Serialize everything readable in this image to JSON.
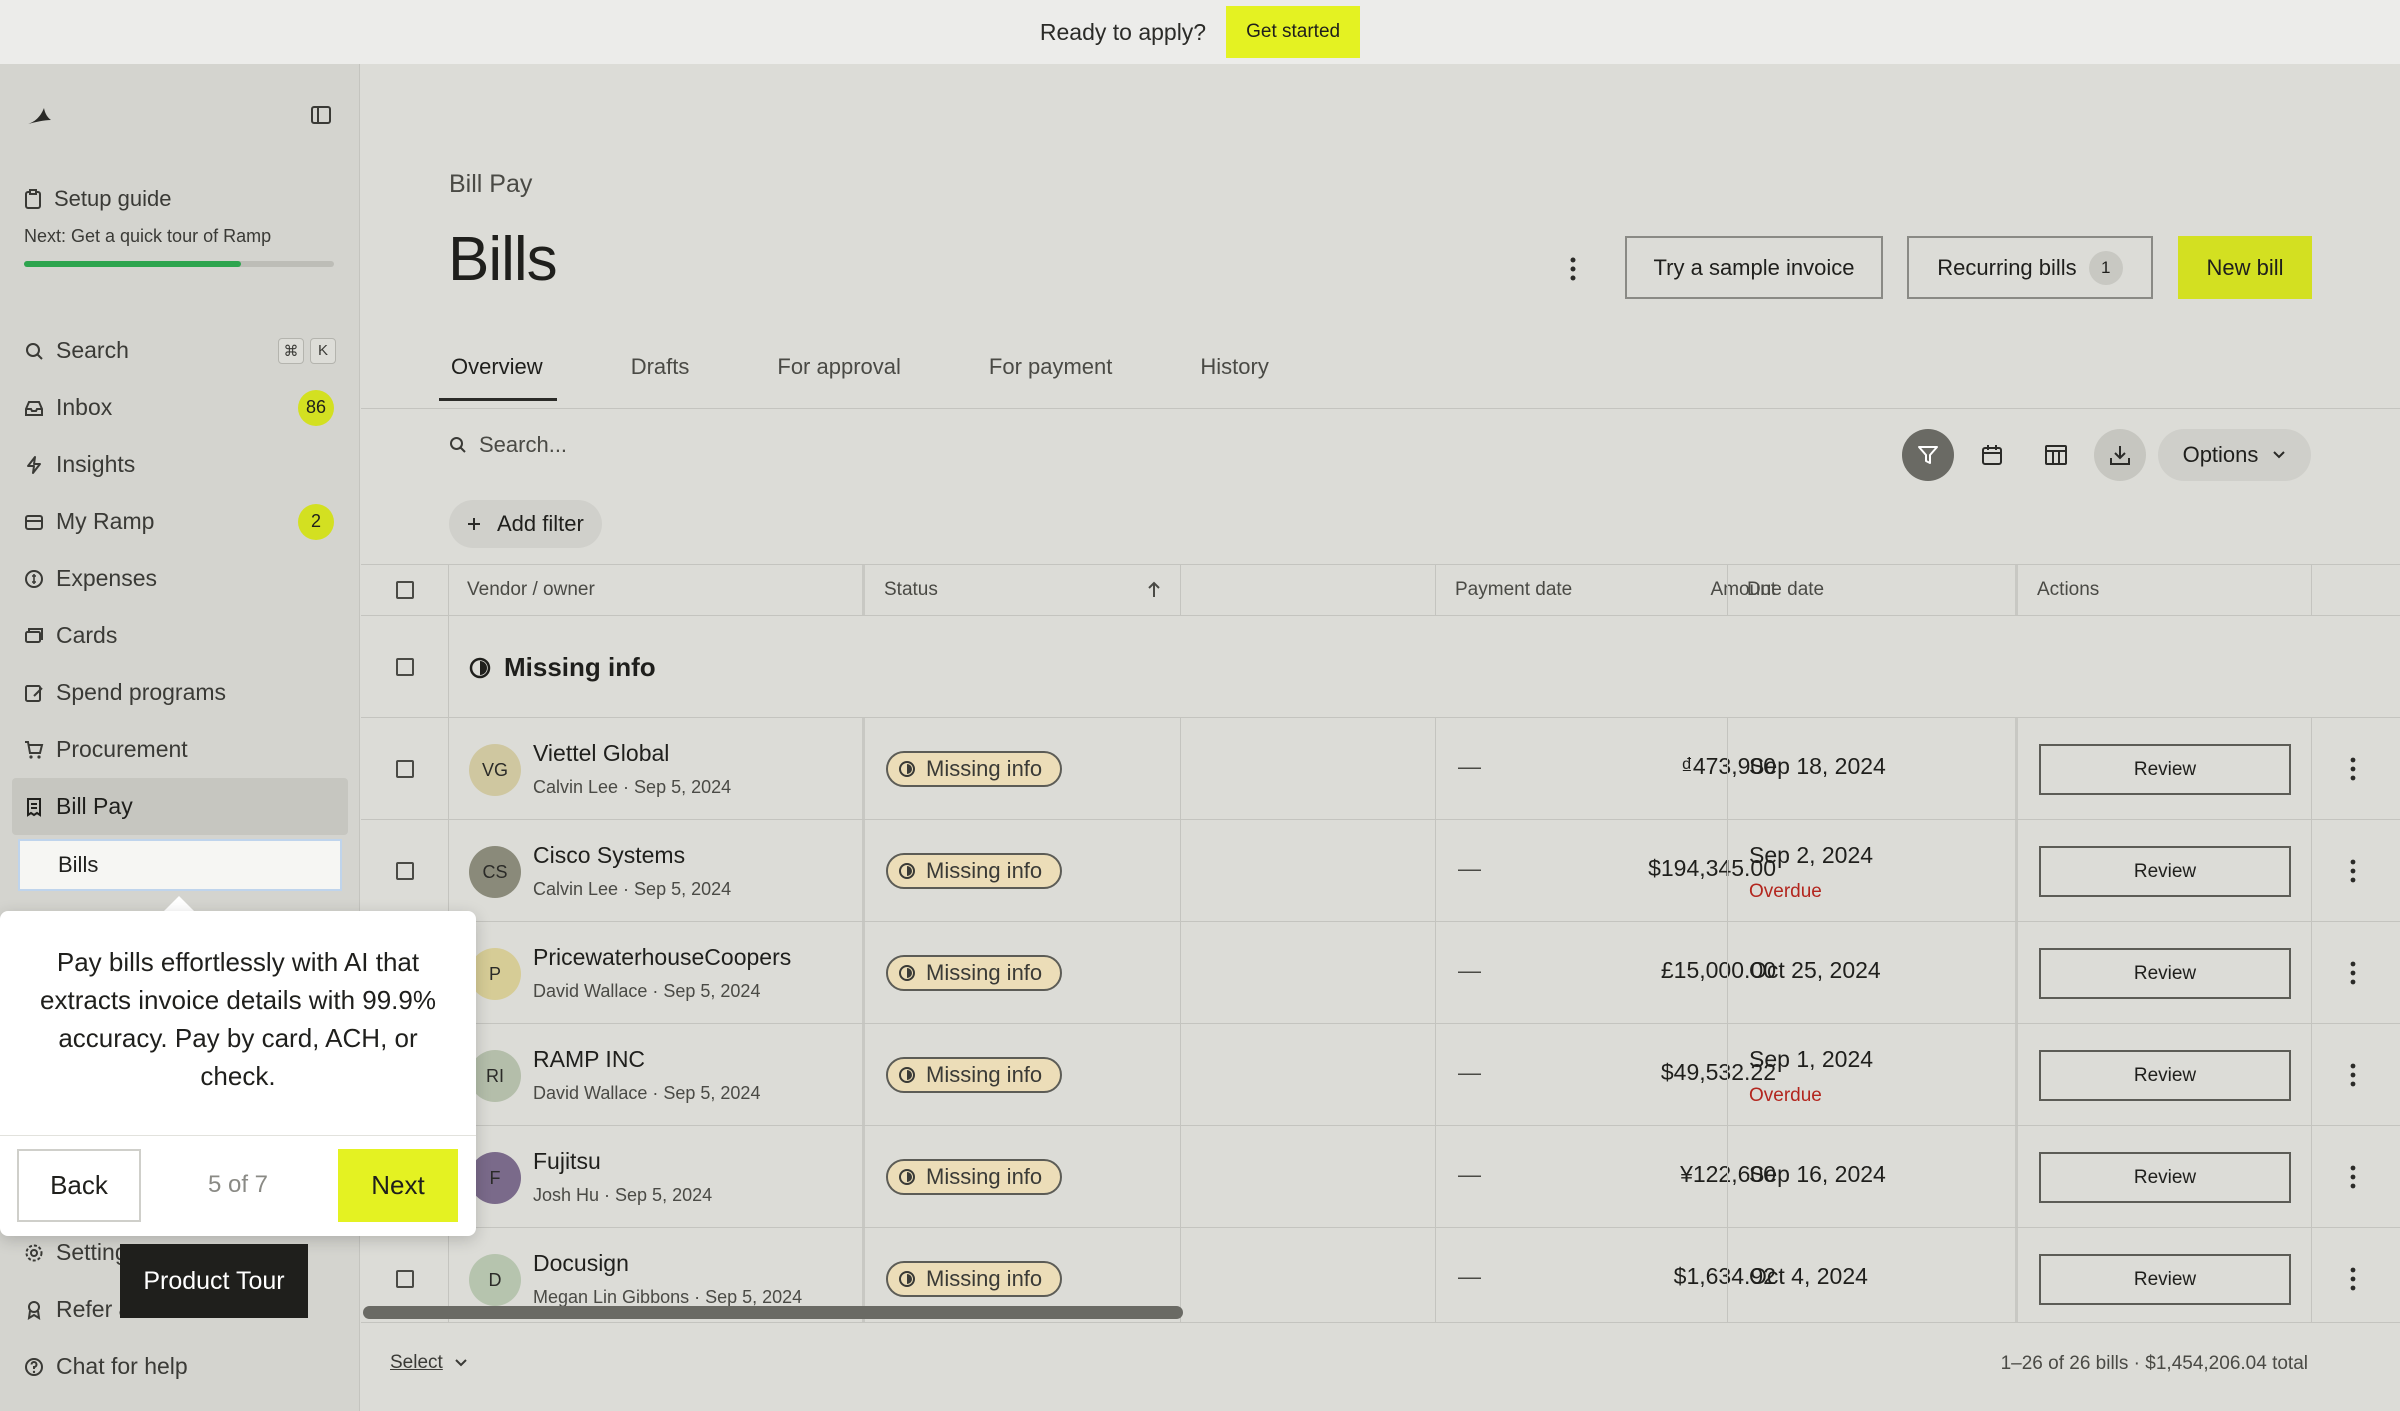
{
  "banner": {
    "text": "Ready to apply?",
    "button": "Get started"
  },
  "sidebar": {
    "setup": {
      "title": "Setup guide",
      "next": "Next: Get a quick tour of Ramp",
      "progress": 0.7
    },
    "items": [
      {
        "label": "Search",
        "icon": "search-icon",
        "kbd": [
          "⌘",
          "K"
        ]
      },
      {
        "label": "Inbox",
        "icon": "inbox-icon",
        "count": "86"
      },
      {
        "label": "Insights",
        "icon": "lightning-icon"
      },
      {
        "label": "My Ramp",
        "icon": "wallet-icon",
        "count": "2"
      },
      {
        "label": "Expenses",
        "icon": "expenses-icon"
      },
      {
        "label": "Cards",
        "icon": "cards-icon"
      },
      {
        "label": "Spend programs",
        "icon": "spend-programs-icon"
      },
      {
        "label": "Procurement",
        "icon": "cart-icon"
      },
      {
        "label": "Bill Pay",
        "icon": "bill-icon"
      }
    ],
    "sub_item": "Bills",
    "bottom": [
      {
        "label": "Settings",
        "icon": "gear-icon"
      },
      {
        "label": "Refer & earn",
        "icon": "award-icon"
      },
      {
        "label": "Chat for help",
        "icon": "help-icon"
      }
    ]
  },
  "header": {
    "breadcrumb": "Bill Pay",
    "title": "Bills",
    "sample_button": "Try a sample invoice",
    "recurring_button": "Recurring bills",
    "recurring_count": "1",
    "new_button": "New bill"
  },
  "tabs": [
    "Overview",
    "Drafts",
    "For approval",
    "For payment",
    "History"
  ],
  "toolbar": {
    "search_placeholder": "Search...",
    "options": "Options",
    "add_filter": "Add filter"
  },
  "table": {
    "columns": [
      "Vendor / owner",
      "Status",
      "Amount",
      "Payment date",
      "Due date",
      "Actions"
    ],
    "group": "Missing info",
    "rows": [
      {
        "initials": "VG",
        "avatar_color": "#cfc7a0",
        "vendor": "Viettel Global",
        "owner": "Calvin Lee · Sep 5, 2024",
        "status": "Missing info",
        "amount": "₫473,900",
        "payment_date": "—",
        "due": "Sep 18, 2024",
        "overdue": "",
        "action": "Review"
      },
      {
        "initials": "CS",
        "avatar_color": "#8a8a7a",
        "vendor": "Cisco Systems",
        "owner": "Calvin Lee · Sep 5, 2024",
        "status": "Missing info",
        "amount": "$194,345.00",
        "payment_date": "—",
        "due": "Sep 2, 2024",
        "overdue": "Overdue",
        "action": "Review"
      },
      {
        "initials": "P",
        "avatar_color": "#d6cc96",
        "vendor": "PricewaterhouseCoopers",
        "owner": "David Wallace · Sep 5, 2024",
        "status": "Missing info",
        "amount": "£15,000.00",
        "payment_date": "—",
        "due": "Oct 25, 2024",
        "overdue": "",
        "action": "Review"
      },
      {
        "initials": "RI",
        "avatar_color": "#b4beaa",
        "vendor": "RAMP INC",
        "owner": "David Wallace · Sep 5, 2024",
        "status": "Missing info",
        "amount": "$49,532.22",
        "payment_date": "—",
        "due": "Sep 1, 2024",
        "overdue": "Overdue",
        "action": "Review"
      },
      {
        "initials": "F",
        "avatar_color": "#7a6a8a",
        "vendor": "Fujitsu",
        "owner": "Josh Hu · Sep 5, 2024",
        "status": "Missing info",
        "amount": "¥122,600",
        "payment_date": "—",
        "due": "Sep 16, 2024",
        "overdue": "",
        "action": "Review"
      },
      {
        "initials": "D",
        "avatar_color": "#b6c4ae",
        "vendor": "Docusign",
        "owner": "Megan Lin Gibbons · Sep 5, 2024",
        "status": "Missing info",
        "amount": "$1,634.92",
        "payment_date": "—",
        "due": "Oct 4, 2024",
        "overdue": "",
        "action": "Review"
      }
    ]
  },
  "footer": {
    "select": "Select",
    "summary": "1–26 of 26 bills  ·  $1,454,206.04 total"
  },
  "tour": {
    "text": "Pay bills effortlessly with AI that extracts invoice details with 99.9% accuracy. Pay by card, ACH, or check.",
    "back": "Back",
    "step": "5 of 7",
    "next": "Next",
    "launcher": "Product Tour"
  },
  "colors": {
    "accent": "#e4f222",
    "overdue": "#b3261e",
    "progress": "#2da44e"
  }
}
